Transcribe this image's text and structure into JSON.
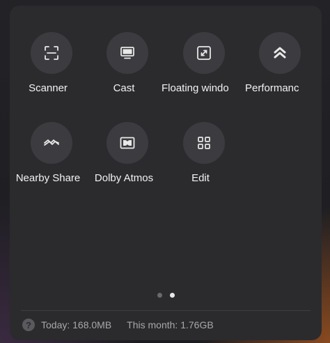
{
  "tiles": [
    {
      "label": "Scanner",
      "icon": "scanner-icon"
    },
    {
      "label": "Cast",
      "icon": "cast-icon"
    },
    {
      "label": "Floating windo",
      "icon": "floating-window-icon"
    },
    {
      "label": "Performanc",
      "icon": "performance-icon"
    },
    {
      "label": "Nearby Share",
      "icon": "nearby-share-icon"
    },
    {
      "label": "Dolby Atmos",
      "icon": "dolby-atmos-icon"
    },
    {
      "label": "Edit",
      "icon": "edit-grid-icon"
    }
  ],
  "pager": {
    "total": 2,
    "active": 2
  },
  "footer": {
    "help_symbol": "?",
    "today": "Today: 168.0MB",
    "month": "This month: 1.76GB"
  },
  "colors": {
    "panel": "#2b2b2e",
    "tile": "#3c3c40",
    "text": "#f2f2f2",
    "muted": "#a8a8ac"
  }
}
